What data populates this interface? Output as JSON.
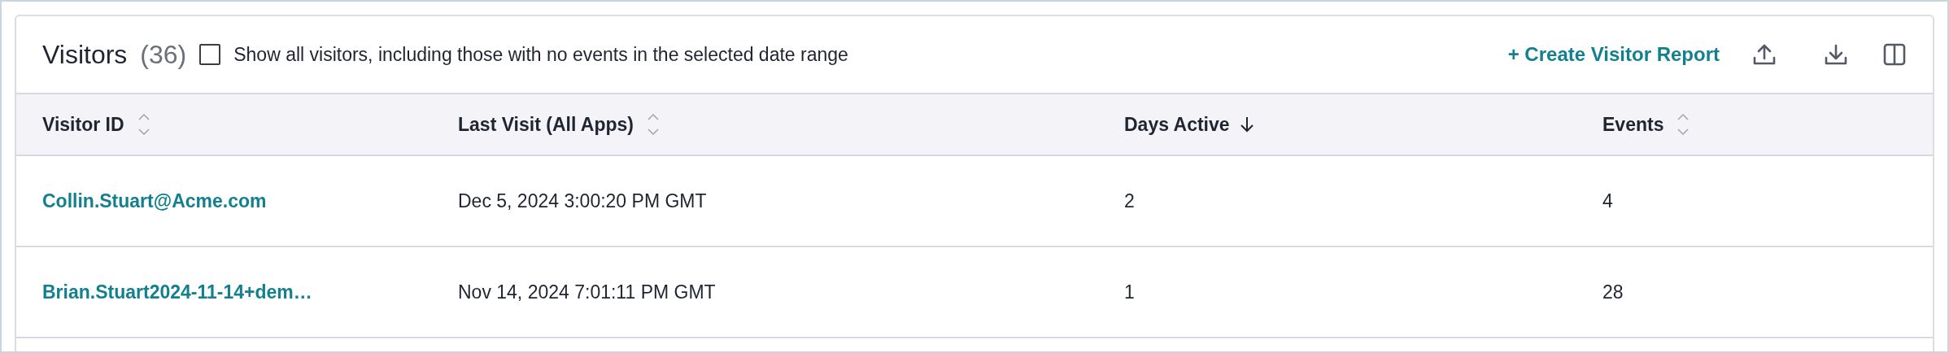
{
  "title": "Visitors",
  "count": "(36)",
  "show_all": {
    "label": "Show all visitors, including those with no events in the selected date range",
    "checked": false
  },
  "create_report": "+ Create Visitor Report",
  "table": {
    "columns": [
      {
        "label": "Visitor ID",
        "sorted": false
      },
      {
        "label": "Last Visit (All Apps)",
        "sorted": false
      },
      {
        "label": "Days Active",
        "sorted": true
      },
      {
        "label": "Events",
        "sorted": false
      }
    ],
    "rows": [
      [
        "Collin.Stuart@Acme.com",
        "Dec 5, 2024 3:00:20 PM GMT",
        "2",
        "4"
      ],
      [
        "Brian.Stuart2024-11-14+dem…",
        "Nov 14, 2024 7:01:11 PM GMT",
        "1",
        "28"
      ]
    ]
  }
}
